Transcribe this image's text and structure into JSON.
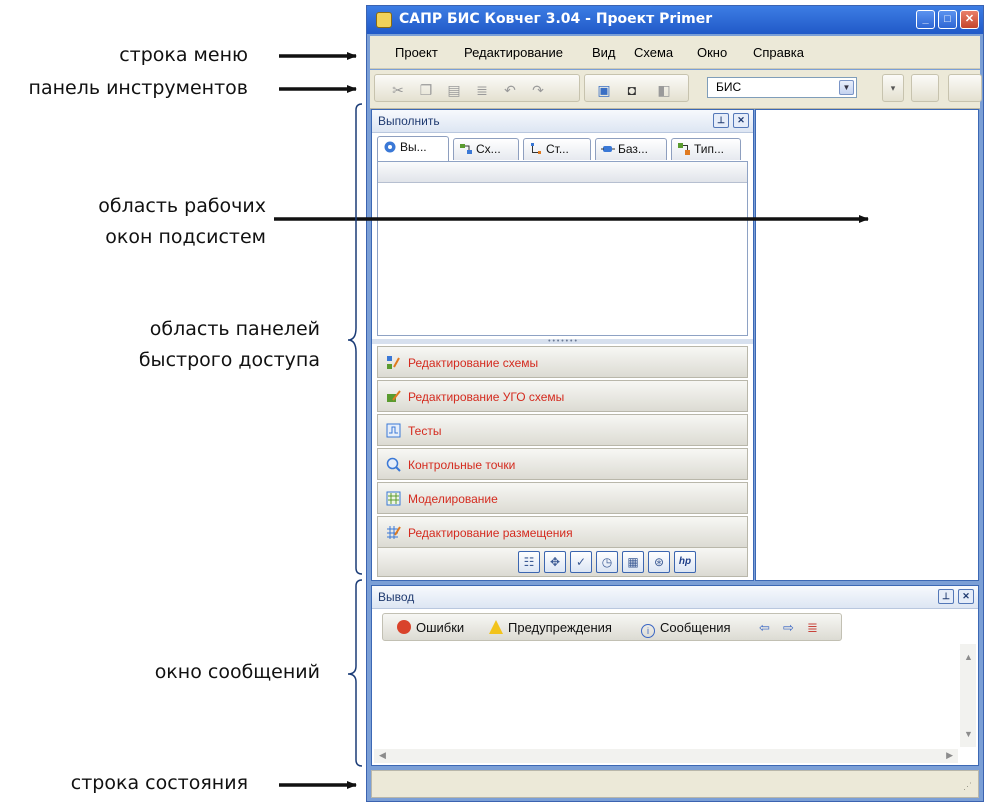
{
  "annotations": {
    "menu_row": "строка меню",
    "toolbar": "панель инструментов",
    "workarea_line1": "область рабочих",
    "workarea_line2": "окон подсистем",
    "quick_line1": "область панелей",
    "quick_line2": "быстрого доступа",
    "messages": "окно сообщений",
    "status": "строка состояния"
  },
  "window": {
    "title": "САПР БИС Ковчег 3.04 - Проект Primer",
    "menu": [
      "Проект",
      "Редактирование",
      "Вид",
      "Схема",
      "Окно",
      "Справка"
    ],
    "combo_value": "БИС"
  },
  "quick_panel": {
    "title": "Выполнить",
    "tabs": [
      "Вы...",
      "Сх...",
      "Ст...",
      "Баз...",
      "Тип..."
    ],
    "items": [
      "Редактирование схемы",
      "Редактирование УГО схемы",
      "Тесты",
      "Контрольные точки",
      "Моделирование",
      "Редактирование размещения"
    ]
  },
  "output": {
    "title": "Вывод",
    "errors": "Ошибки",
    "warnings": "Предупреждения",
    "messages": "Сообщения"
  },
  "colors": {
    "accent": "#2159c8",
    "item_text": "#d42b1f",
    "error": "#d9432b",
    "warning": "#f2c31b",
    "info": "#3a66c4"
  }
}
